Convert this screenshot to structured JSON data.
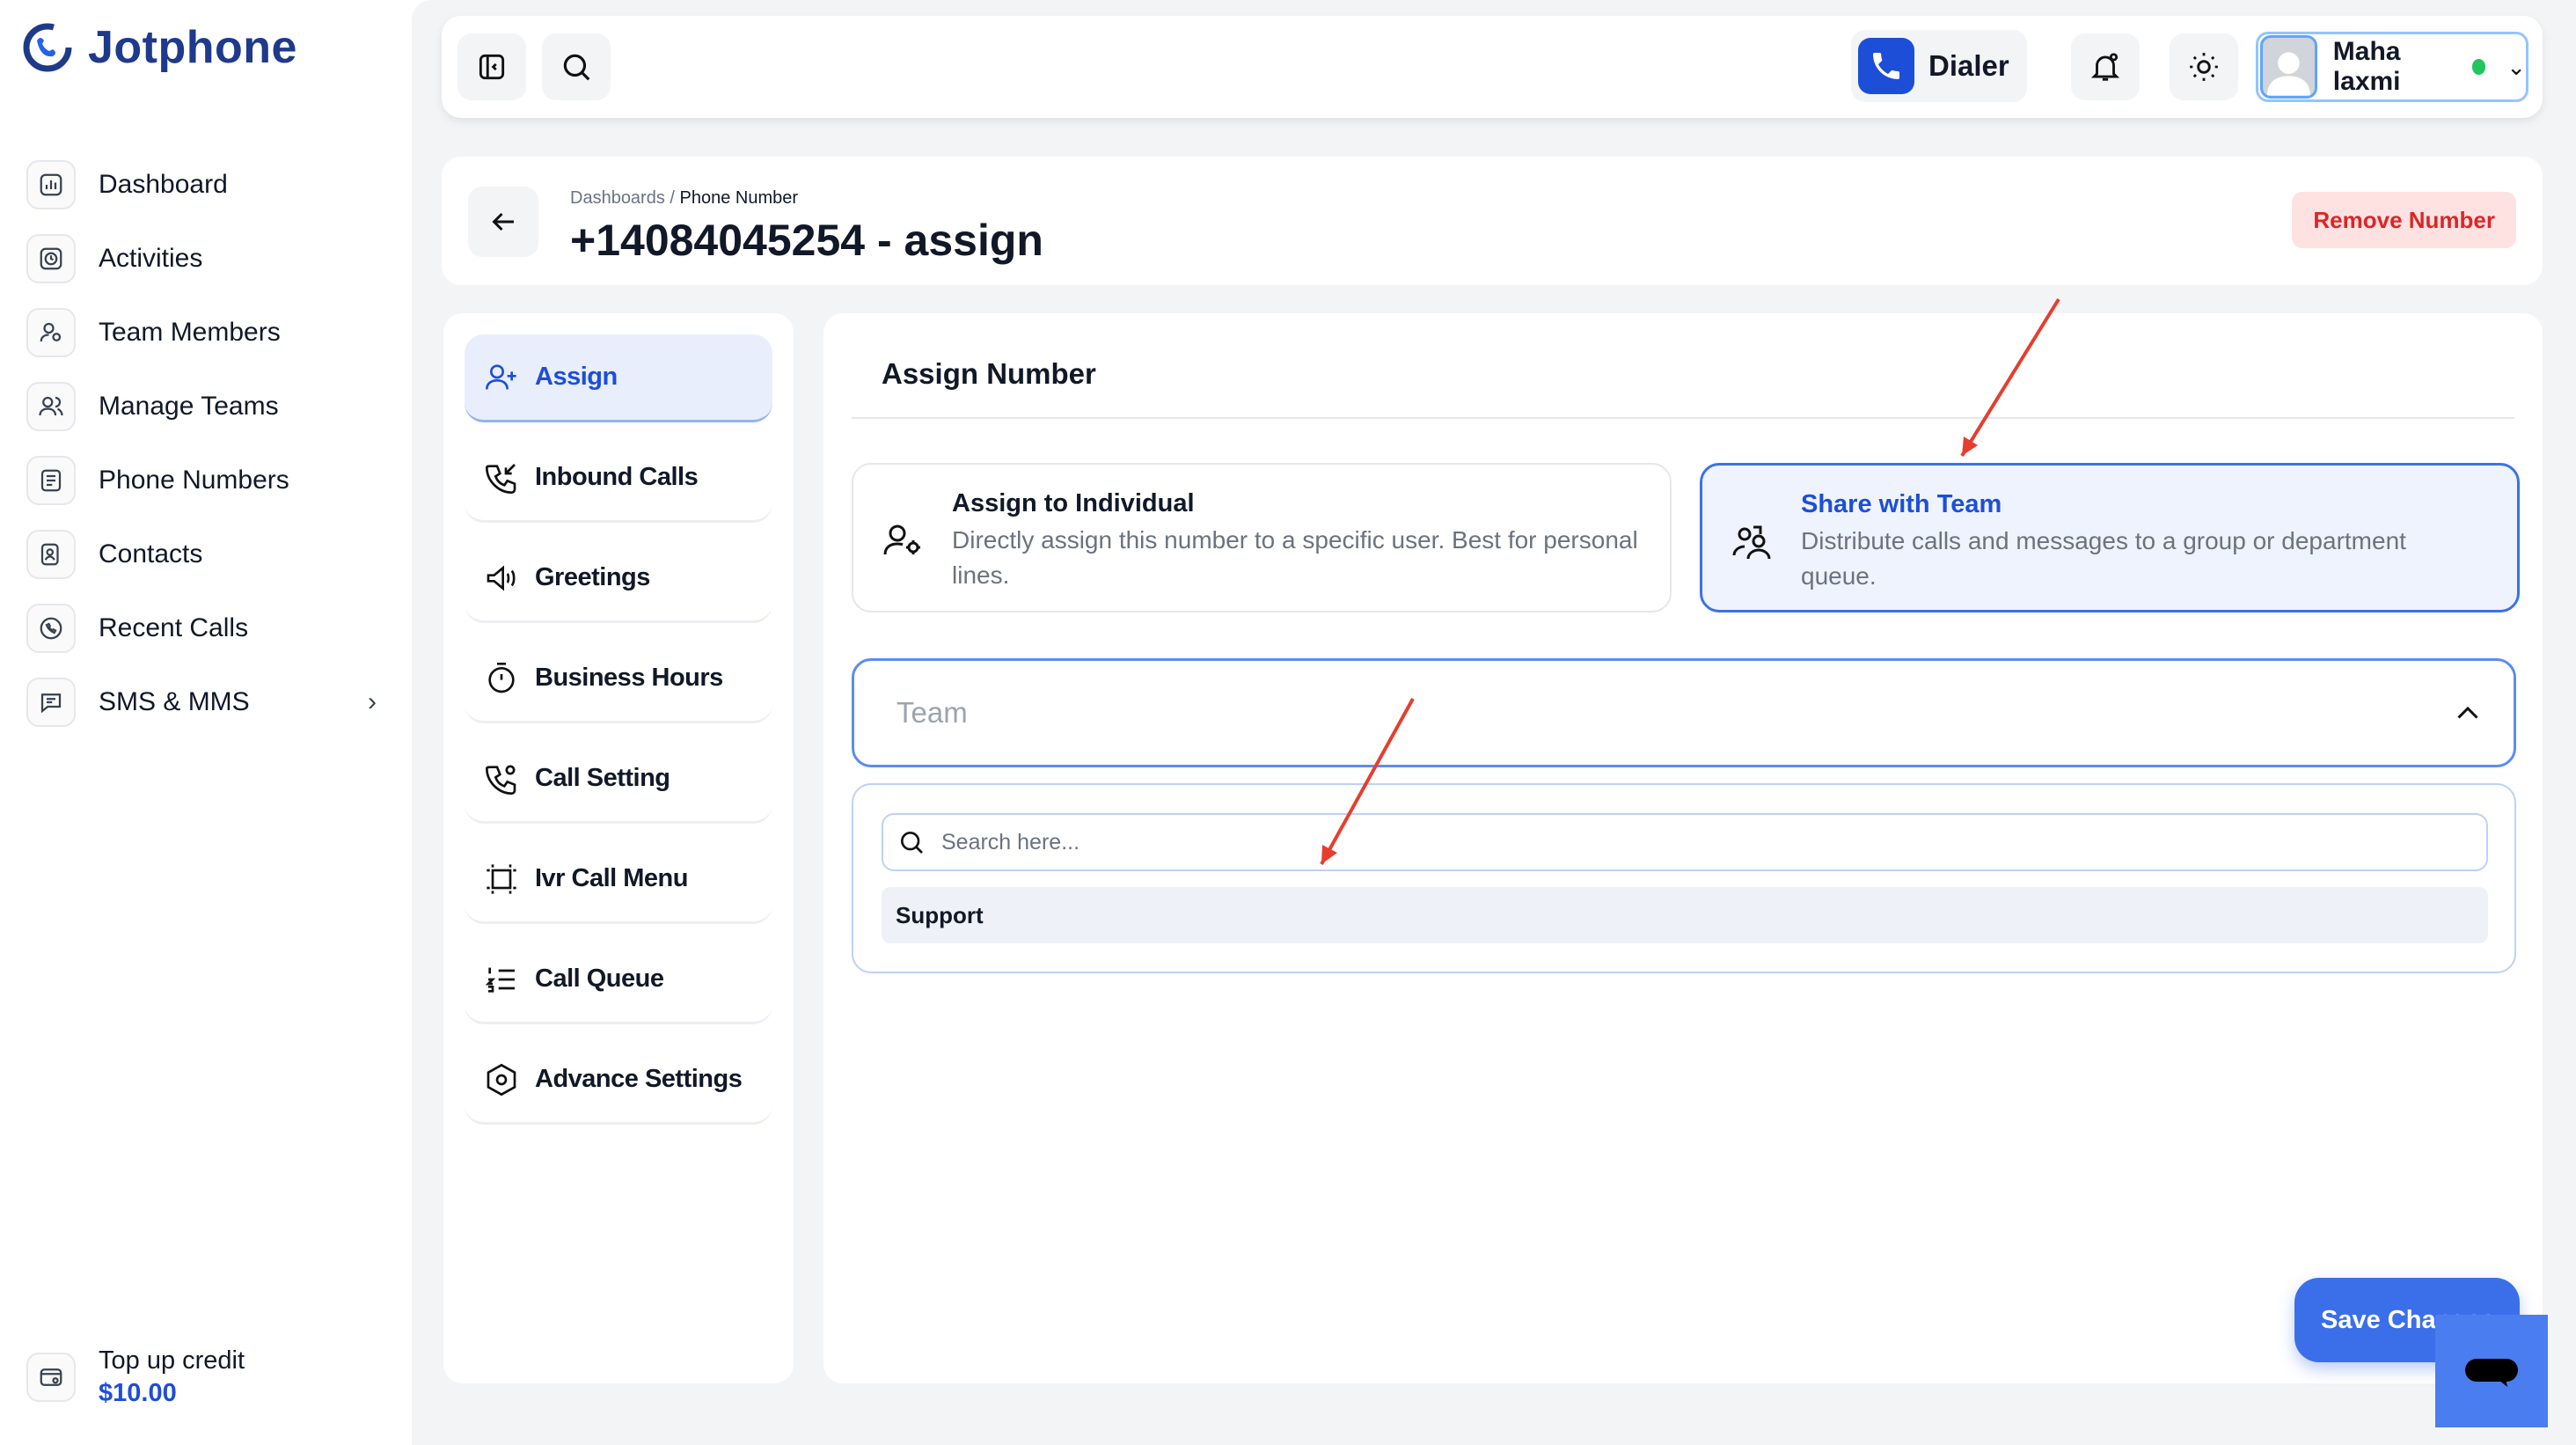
{
  "app": {
    "name": "Jotphone"
  },
  "sidebar": {
    "items": [
      {
        "label": "Dashboard",
        "icon": "chart-icon"
      },
      {
        "label": "Activities",
        "icon": "activity-icon"
      },
      {
        "label": "Team Members",
        "icon": "team-members-icon"
      },
      {
        "label": "Manage Teams",
        "icon": "teams-icon"
      },
      {
        "label": "Phone Numbers",
        "icon": "phone-list-icon"
      },
      {
        "label": "Contacts",
        "icon": "contacts-icon"
      },
      {
        "label": "Recent Calls",
        "icon": "recent-calls-icon"
      },
      {
        "label": "SMS & MMS",
        "icon": "message-icon"
      }
    ],
    "topup": {
      "label": "Top up credit",
      "amount": "$10.00"
    }
  },
  "topbar": {
    "dialer_label": "Dialer",
    "user_name": "Maha laxmi",
    "status_color": "#22c55e"
  },
  "header": {
    "breadcrumb_root": "Dashboards",
    "breadcrumb_sep": "/",
    "breadcrumb_current": "Phone Number",
    "title": "+14084045254 - assign",
    "remove_label": "Remove Number"
  },
  "tabs": [
    {
      "label": "Assign",
      "icon": "user-plus-icon",
      "active": true
    },
    {
      "label": "Inbound Calls",
      "icon": "inbound-call-icon"
    },
    {
      "label": "Greetings",
      "icon": "megaphone-icon"
    },
    {
      "label": "Business Hours",
      "icon": "timer-icon"
    },
    {
      "label": "Call Setting",
      "icon": "call-settings-icon"
    },
    {
      "label": "Ivr Call Menu",
      "icon": "ivr-icon"
    },
    {
      "label": "Call Queue",
      "icon": "list-ordered-icon"
    },
    {
      "label": "Advance Settings",
      "icon": "hex-settings-icon"
    }
  ],
  "assign": {
    "section_title": "Assign Number",
    "individual": {
      "title": "Assign to Individual",
      "desc": "Directly assign this number to a specific user. Best for personal lines."
    },
    "team": {
      "title": "Share with Team",
      "desc": "Distribute calls and messages to a group or department queue."
    },
    "team_select_placeholder": "Team",
    "search_placeholder": "Search here...",
    "options": [
      "Support"
    ]
  },
  "save_label": "Save Changes",
  "colors": {
    "accent": "#1d4ed8",
    "danger": "#dc2626",
    "annotation": "#e53e2f"
  }
}
